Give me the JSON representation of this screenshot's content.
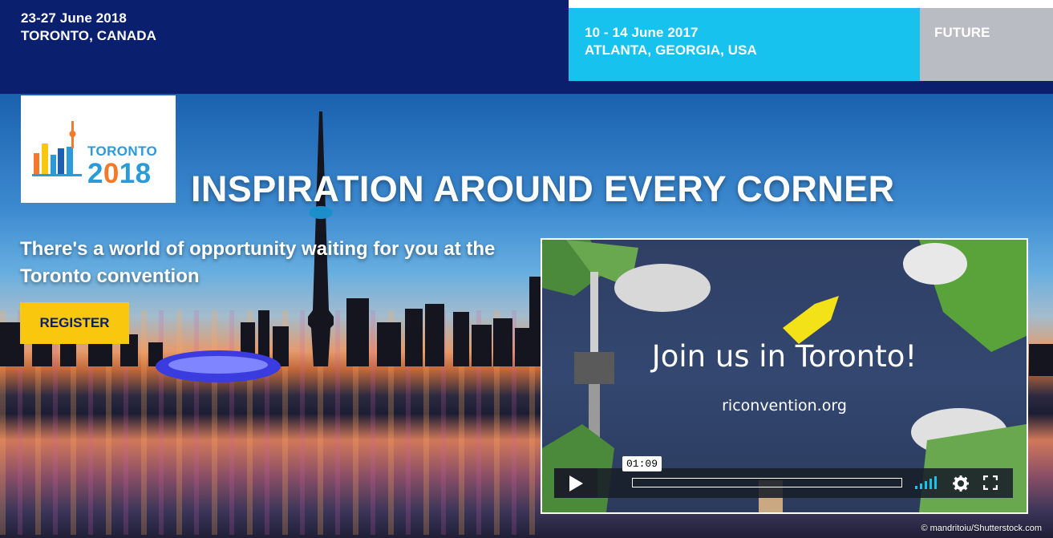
{
  "tabs": [
    {
      "date": "23-27 June 2018",
      "location": "TORONTO, CANADA"
    },
    {
      "date": "10 - 14 June 2017",
      "location": "ATLANTA, GEORGIA, USA"
    },
    {
      "label": "FUTURE"
    }
  ],
  "logo": {
    "word": "TORONTO",
    "year_prefix": "2",
    "year_o": "0",
    "year_suffix": "18"
  },
  "hero": {
    "headline": "INSPIRATION AROUND EVERY CORNER",
    "subhead": "There's a world of opportunity waiting for you at the Toronto convention",
    "register_label": "REGISTER"
  },
  "video": {
    "title": "Join us in Toronto!",
    "url": "riconvention.org",
    "timecode": "01:09",
    "progress": 0
  },
  "credit": "© mandritoiu/Shutterstock.com",
  "colors": {
    "navy": "#0a1f6e",
    "cyan": "#17c3ee",
    "gray": "#b9bcc2",
    "yellow": "#f9c80e",
    "accent_blue": "#2a9ad8",
    "accent_orange": "#f37a2a"
  }
}
